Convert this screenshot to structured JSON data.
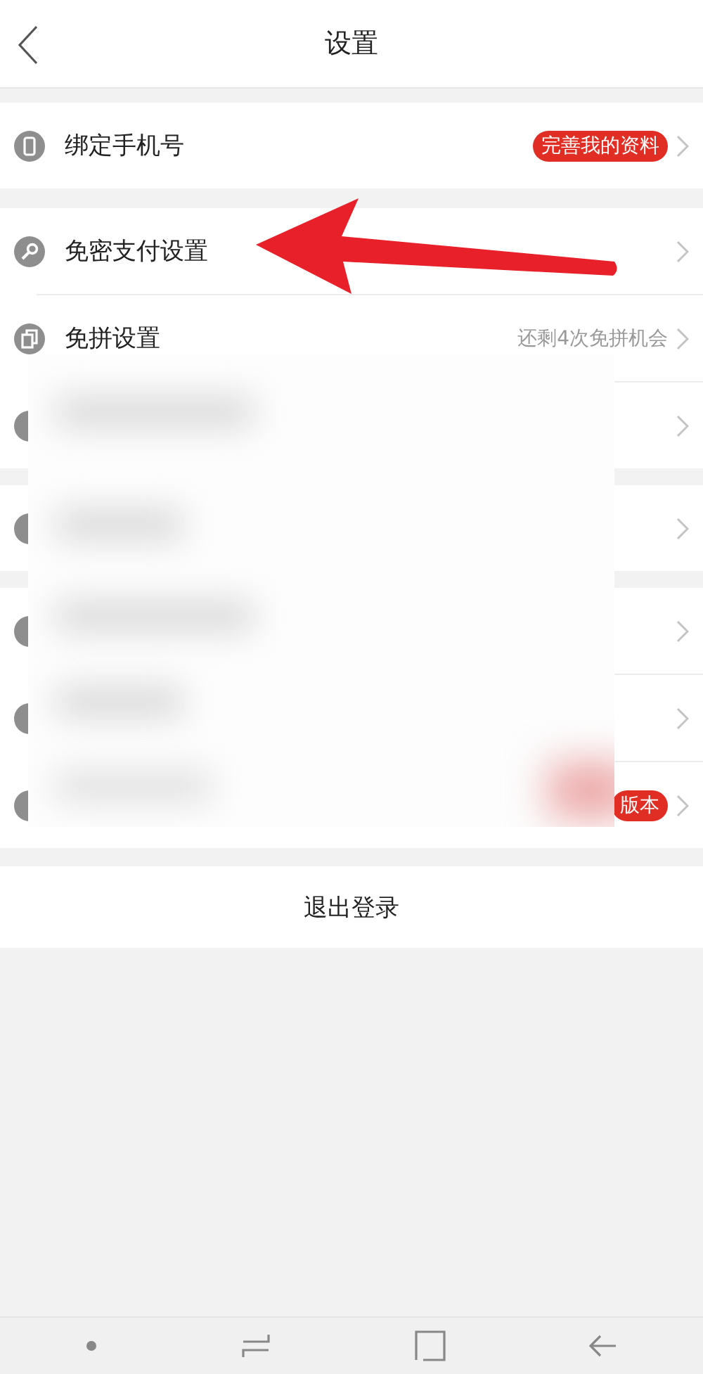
{
  "header": {
    "title": "设置"
  },
  "sections": [
    {
      "rows": [
        {
          "kind": "visible",
          "label": "绑定手机号",
          "badge": "完善我的资料"
        }
      ]
    },
    {
      "rows": [
        {
          "kind": "visible",
          "label": "免密支付设置"
        },
        {
          "kind": "visible",
          "label": "免拼设置",
          "value": "还剩4次免拼机会"
        },
        {
          "kind": "hidden"
        }
      ]
    },
    {
      "rows": [
        {
          "kind": "hidden"
        }
      ]
    },
    {
      "rows": [
        {
          "kind": "hidden"
        },
        {
          "kind": "hidden"
        },
        {
          "kind": "hidden",
          "badge": "版本"
        }
      ]
    }
  ],
  "logout": "退出登录"
}
